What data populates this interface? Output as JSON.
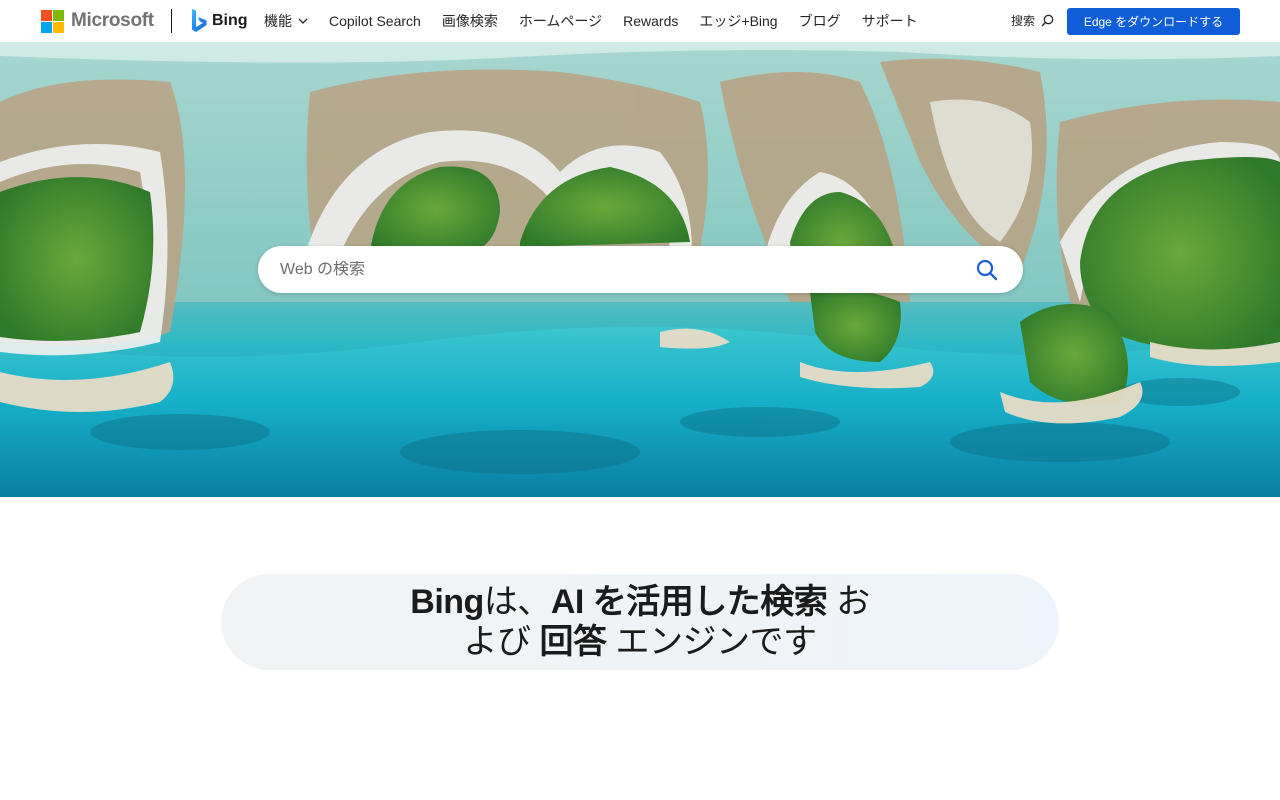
{
  "header": {
    "brand": "Microsoft",
    "product": "Bing",
    "nav": [
      {
        "label": "機能",
        "has_dropdown": true
      },
      {
        "label": "Copilot Search"
      },
      {
        "label": "画像検索"
      },
      {
        "label": "ホームページ"
      },
      {
        "label": "Rewards"
      },
      {
        "label": "エッジ+Bing"
      },
      {
        "label": "ブログ"
      },
      {
        "label": "サポート"
      }
    ],
    "search_label": "搜索",
    "search_icon": "search-icon",
    "cta_label": "Edge をダウンロードする"
  },
  "hero": {
    "search_placeholder": "Web の検索",
    "search_button_icon": "search-icon"
  },
  "tagline": {
    "part1": "Bing",
    "part2": "は、",
    "part3": "AI を活用した検索",
    "part4": "お",
    "part5": "よび",
    "part6": "回答",
    "part7": "エンジンです"
  },
  "colors": {
    "accent": "#0f5ed8",
    "ms_red": "#f25022",
    "ms_green": "#7fba00",
    "ms_blue": "#00a4ef",
    "ms_yellow": "#ffb900"
  }
}
